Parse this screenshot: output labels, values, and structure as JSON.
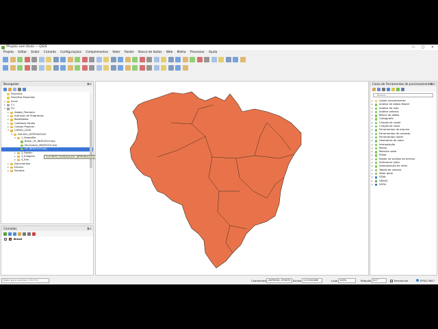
{
  "window": {
    "title": "*Projeto sem título — QGIS",
    "controls": [
      "—",
      "□",
      "✕"
    ]
  },
  "menu": [
    "Projeto",
    "Editar",
    "Exibir",
    "Camada",
    "Configurações",
    "Complementos",
    "Vetor",
    "Raster",
    "Banco de dados",
    "Web",
    "Malha",
    "Processar",
    "Ajuda"
  ],
  "browser": {
    "title": "Navegador",
    "items": [
      {
        "label": "Favoritos",
        "depth": 0,
        "arrow": "",
        "icon": "star"
      },
      {
        "label": "Favoritos Espaciais",
        "depth": 0,
        "arrow": "",
        "icon": "star"
      },
      {
        "label": "Início",
        "depth": 0,
        "arrow": "▸",
        "icon": "folder"
      },
      {
        "label": "C:\\",
        "depth": 0,
        "arrow": "▸",
        "icon": "drive"
      },
      {
        "label": "D:\\",
        "depth": 0,
        "arrow": "▾",
        "icon": "drive"
      },
      {
        "label": "Adobe_Premiere",
        "depth": 1,
        "arrow": "▸",
        "icon": "folder"
      },
      {
        "label": "Arquivos de Programas",
        "depth": 1,
        "arrow": "▸",
        "icon": "folder"
      },
      {
        "label": "BaseDados",
        "depth": 1,
        "arrow": "▸",
        "icon": "folder"
      },
      {
        "label": "Camtasia Studio",
        "depth": 1,
        "arrow": "▸",
        "icon": "folder"
      },
      {
        "label": "Carbon Projects",
        "depth": 1,
        "arrow": "▸",
        "icon": "folder"
      },
      {
        "label": "CURSO_QGIS",
        "depth": 1,
        "arrow": "▾",
        "icon": "folder"
      },
      {
        "label": "AULA01_INTRODUCAO",
        "depth": 2,
        "arrow": "▾",
        "icon": "folder"
      },
      {
        "label": "1_Shapefile",
        "depth": 3,
        "arrow": "▾",
        "icon": "folder"
      },
      {
        "label": "Brasil_UF_IBGE2019.shp",
        "depth": 4,
        "arrow": "",
        "icon": "shp"
      },
      {
        "label": "Municipios_IBGE2019.shp",
        "depth": 4,
        "arrow": "",
        "icon": "shp"
      },
      {
        "label": "UF_IBGE2019.shp",
        "depth": 4,
        "arrow": "",
        "icon": "shp",
        "selected": true
      },
      {
        "label": "2_Raster",
        "depth": 3,
        "arrow": "▸",
        "icon": "folder"
      },
      {
        "label": "3_Imagens",
        "depth": 3,
        "arrow": "▸",
        "icon": "folder"
      },
      {
        "label": "4_Kml",
        "depth": 3,
        "arrow": "▸",
        "icon": "folder"
      },
      {
        "label": "Documentos",
        "depth": 1,
        "arrow": "▸",
        "icon": "folder"
      },
      {
        "label": "Drivers",
        "depth": 1,
        "arrow": "▸",
        "icon": "folder"
      },
      {
        "label": "Estudos",
        "depth": 1,
        "arrow": "▸",
        "icon": "folder"
      }
    ],
    "tooltip": "D:\\CURSO_QGIS\\AULA01_INTRODUCAO\\1_Shapefile\\Municipios\\UF_IBGE2019.shp"
  },
  "layers": {
    "title": "Camadas",
    "items": [
      {
        "label": "Brasil",
        "checked": true,
        "color": "#e8734a"
      }
    ]
  },
  "processing": {
    "title": "Caixa de Ferramentas de processamento",
    "search_placeholder": "Buscar...",
    "items": [
      {
        "label": "Usado recentemente",
        "icon": "#f5c542"
      },
      {
        "label": "Análise de dados Raster",
        "icon": "#71c44c"
      },
      {
        "label": "Análise de rede",
        "icon": "#71c44c"
      },
      {
        "label": "Análise vetorial",
        "icon": "#71c44c"
      },
      {
        "label": "Banco de dados",
        "icon": "#71c44c"
      },
      {
        "label": "Cartografia",
        "icon": "#71c44c"
      },
      {
        "label": "Criação de raster",
        "icon": "#71c44c"
      },
      {
        "label": "Criação de vetor",
        "icon": "#71c44c"
      },
      {
        "label": "Ferramentas de arquivo",
        "icon": "#71c44c"
      },
      {
        "label": "Ferramentas de camada",
        "icon": "#71c44c"
      },
      {
        "label": "Ferramentas raster",
        "icon": "#71c44c"
      },
      {
        "label": "Geometria de vetor",
        "icon": "#71c44c"
      },
      {
        "label": "Interpolação",
        "icon": "#71c44c"
      },
      {
        "label": "Malha",
        "icon": "#71c44c"
      },
      {
        "label": "Mosaico vetor",
        "icon": "#71c44c"
      },
      {
        "label": "Plotar",
        "icon": "#71c44c"
      },
      {
        "label": "Raster de análise do terreno",
        "icon": "#71c44c"
      },
      {
        "label": "Selecionar vetor",
        "icon": "#71c44c"
      },
      {
        "label": "Sobreposição de vetor",
        "icon": "#71c44c"
      },
      {
        "label": "Tabela de vetores",
        "icon": "#71c44c"
      },
      {
        "label": "Vetor geral",
        "icon": "#71c44c"
      },
      {
        "label": "GDAL",
        "icon": "#3a7fd1"
      },
      {
        "label": "GRASS",
        "icon": "#3a9e3a"
      },
      {
        "label": "SAGA",
        "icon": "#2c58a0"
      }
    ]
  },
  "status": {
    "search_placeholder": "Digite para localizar (Ctrl+K)",
    "coord_label": "Coordenada",
    "coord_value": "-4676943,-976070",
    "scale_label": "Escala",
    "scale_value": "1:11341468",
    "lupa_label": "Lupa",
    "lupa_value": "100%",
    "rot_label": "Rotação",
    "rot_value": "0,0 °",
    "render_label": "Renderizar",
    "crs": "EPSG:3857"
  },
  "map": {
    "fill": "#e8734a",
    "stroke": "#3a2a20"
  },
  "colors": {
    "accent": "#3875d7"
  }
}
